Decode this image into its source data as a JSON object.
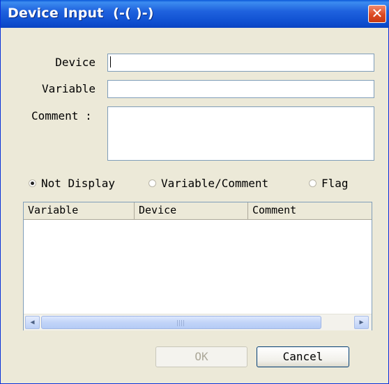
{
  "window": {
    "title": "Device Input  (-( )-)"
  },
  "form": {
    "device_label": "Device",
    "device_value": "",
    "variable_label": "Variable",
    "variable_value": "",
    "comment_label": "Comment :",
    "comment_value": ""
  },
  "display_options": [
    {
      "label": "Not Display",
      "selected": true
    },
    {
      "label": "Variable/Comment",
      "selected": false
    },
    {
      "label": "Flag",
      "selected": false
    }
  ],
  "list": {
    "columns": [
      "Variable",
      "Device",
      "Comment"
    ],
    "rows": []
  },
  "buttons": {
    "ok_label": "OK",
    "ok_enabled": false,
    "cancel_label": "Cancel"
  },
  "icons": {
    "close": "close-icon",
    "scroll_left": "arrow-left-icon",
    "scroll_right": "arrow-right-icon"
  },
  "colors": {
    "titlebar": "#0f4fd0",
    "close_button": "#dd4a22",
    "dialog_bg": "#ece9d8"
  }
}
